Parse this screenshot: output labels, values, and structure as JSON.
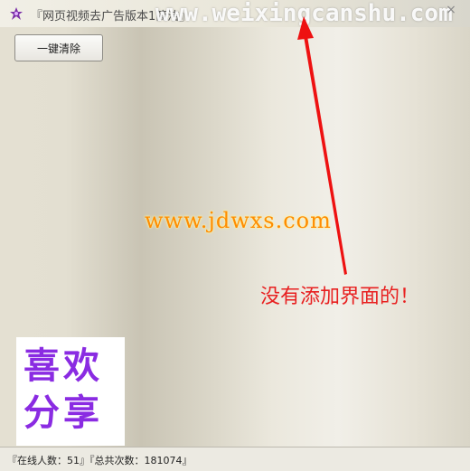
{
  "window": {
    "title": "『网页视频去广告版本1简洁』",
    "watermark": "www.weixingcanshu.com",
    "close_symbol": "×"
  },
  "toolbar": {
    "clear_button_label": "一键清除"
  },
  "overlay": {
    "url_watermark": "www.jdwxs.com",
    "annotation": "没有添加界面的！"
  },
  "badge": {
    "line1": "喜欢",
    "line2": "分享"
  },
  "status": {
    "text": "『在线人数：51』『总共次数：181074』"
  },
  "colors": {
    "annotation": "#e82020",
    "badge_text": "#8a2be2",
    "url_watermark": "#ff8c00"
  }
}
